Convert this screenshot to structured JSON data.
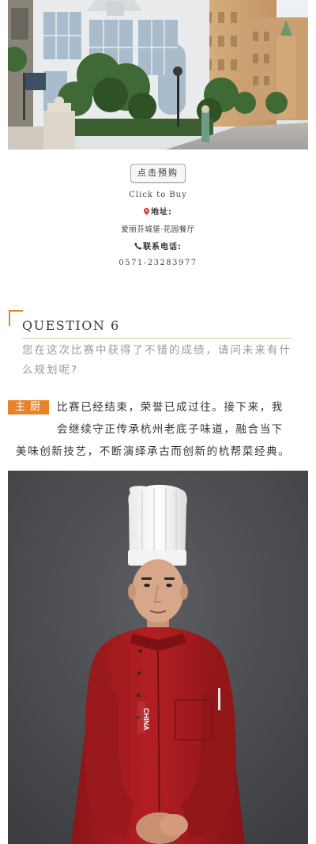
{
  "booking": {
    "button_label": "点击预购",
    "click_to_buy": "Click to Buy",
    "address_label": "地址:",
    "address_value": "爱丽芬城堡·花园餐厅",
    "phone_label": "联系电话:",
    "phone_value": "0571-23283977"
  },
  "question": {
    "title": "QUESTION 6",
    "text": "您在这次比赛中获得了不错的成绩，请问未来有什么规划呢?"
  },
  "answer": {
    "badge": "主厨",
    "line1": "比赛已经结束，荣誉已成过往。接下来，我",
    "line2": "会继续守正传承杭州老底子味道，融合当下",
    "line3": "美味创新技艺，不断演绎承古而创新的杭帮菜经典。"
  },
  "chef_photo": {
    "logo_text": "CHINA"
  },
  "colors": {
    "accent": "#e8832a",
    "rule": "#e6c79e",
    "question_text": "#9a9a9a",
    "pin": "#e0322e",
    "jacket": "#a81c1f",
    "backdrop": "#4a4c50"
  },
  "icons": {
    "address": "map-pin-icon",
    "phone": "phone-icon"
  }
}
